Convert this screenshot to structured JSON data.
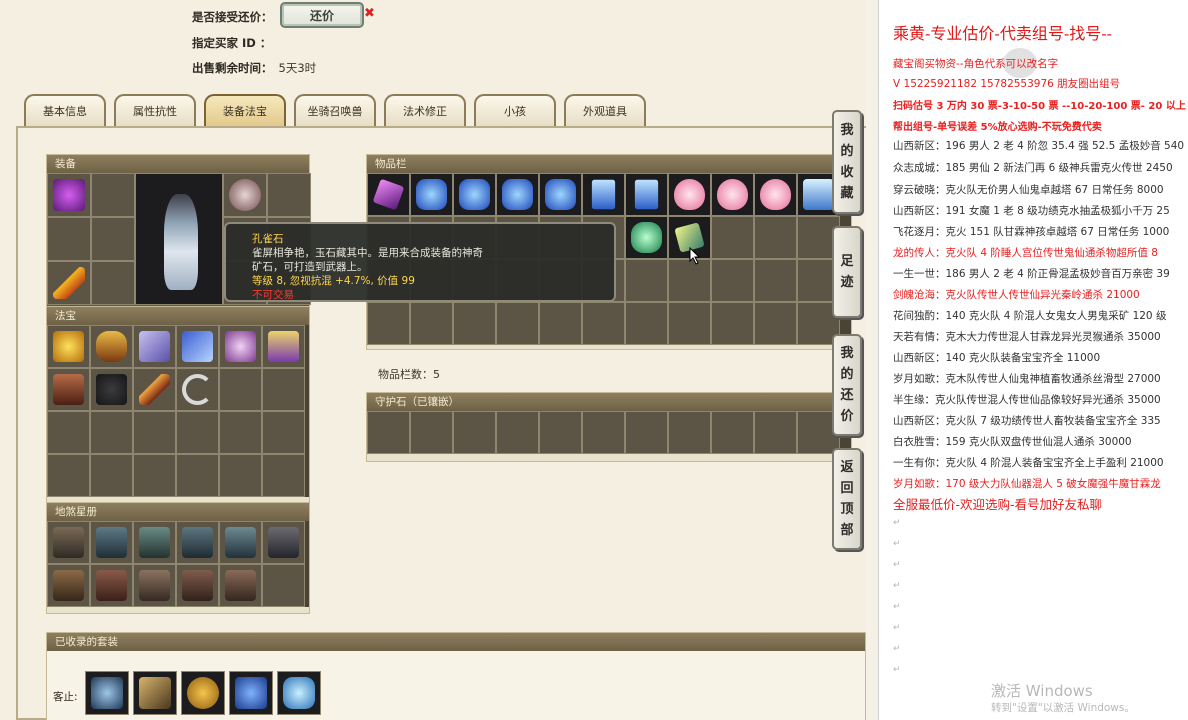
{
  "header": {
    "accept_bargain_label": "是否接受还价：",
    "bargain_button": "还价",
    "bargain_mark": "✖",
    "buyer_id_label": "指定买家 ID ：",
    "time_left_label": "出售剩余时间：",
    "time_left_value": "5天3时"
  },
  "tabs": [
    "基本信息",
    "属性抗性",
    "装备法宝",
    "坐骑召唤兽",
    "法术修正",
    "小孩",
    "外观道具"
  ],
  "active_tab": 2,
  "panels": {
    "equipment": "装备",
    "treasure": "法宝",
    "stars": "地煞星册",
    "inventory": "物品栏",
    "inventory_count": "物品栏数：5",
    "guard_stone": "守护石（已镶嵌）",
    "collected_sets": "已收录的套装",
    "collected_prefix": "客止:"
  },
  "tooltip": {
    "name": "孔雀石",
    "desc1": "雀屏相争艳，玉石藏其中。是用来合成装备的神奇",
    "desc2": "矿石，可打造到武器上。",
    "stat": "等级 8, 忽视抗混 +4.7%, 价值 99",
    "warn": "不可交易"
  },
  "side_buttons": [
    {
      "chars": [
        "我",
        "的",
        "收",
        "藏"
      ]
    },
    {
      "chars": [
        "足",
        "迹"
      ]
    },
    {
      "chars": [
        "我",
        "的",
        "还",
        "价"
      ]
    },
    {
      "chars": [
        "返",
        "回",
        "顶",
        "部"
      ]
    }
  ],
  "doc": {
    "title": "乘黄-专业估价-代卖组号-找号--",
    "lines": [
      {
        "text": "藏宝阁买物资--角色代系可以改名字",
        "style": "red"
      },
      {
        "text": "V 15225921182   15782553976 朋友圈出组号",
        "style": "red"
      },
      {
        "text": "扫码估号 3 万内 30 票-3-10-50 票 --10-20-100 票- 20 以上",
        "style": "redb"
      },
      {
        "text": "帮出组号-单号误差 5%放心选购-不玩免费代卖",
        "style": "redb"
      },
      {
        "text": "山西新区：196 男人 2 老 4 阶忽 35.4 强 52.5 孟极妙音 540",
        "style": "normal"
      },
      {
        "text": "众志成城：185 男仙 2 新法门再 6 级神兵雷克火传世 2450",
        "style": "normal"
      },
      {
        "text": "穿云破晓：克火队无价男人仙鬼卓越塔 67 日常任务 8000",
        "style": "normal"
      },
      {
        "text": "山西新区：191 女魔 1 老 8 级功绩克水抽孟极狐小千万 25",
        "style": "normal"
      },
      {
        "text": "飞花逐月：克火 151 队甘霖神孩卓越塔 67 日常任务 1000",
        "style": "normal"
      },
      {
        "text": "龙的传人：克火队 4 阶睡人宫位传世鬼仙通杀物超所值 8",
        "style": "red"
      },
      {
        "text": "一生一世：186 男人 2 老 4 阶正骨混孟极妙音百万亲密 39",
        "style": "normal"
      },
      {
        "text": "剑魄沧海：克火队传世人传世仙异光秦岭通杀 21000",
        "style": "red"
      },
      {
        "text": "花间独酌：140 克火队 4 阶混人女鬼女人男鬼采矿 120 级",
        "style": "normal"
      },
      {
        "text": "天若有情：克木大力传世混人甘霖龙异光灵猴通杀 35000",
        "style": "normal"
      },
      {
        "text": "山西新区：140 克火队装备宝宝齐全 11000",
        "style": "normal"
      },
      {
        "text": "岁月如歌：克木队传世人仙鬼神植畜牧通杀丝滑型 27000",
        "style": "normal"
      },
      {
        "text": "半生缘：克火队传世混人传世仙品像较好异光通杀 35000",
        "style": "normal"
      },
      {
        "text": "山西新区：克火队 7 级功绩传世人畜牧装备宝宝齐全 335",
        "style": "normal"
      },
      {
        "text": "白衣胜雪：159 克火队双盘传世仙混人通杀 30000",
        "style": "normal"
      },
      {
        "text": "一生有你：克火队 4 阶混人装备宝宝齐全上手盈利 21000",
        "style": "normal"
      },
      {
        "text": "岁月如歌：170 级大力队仙器混人 5 破女魔强牛魔甘霖龙",
        "style": "red"
      },
      {
        "text": "全服最低价-欢迎选购-看号加好友私聊",
        "style": "big"
      }
    ],
    "windows_line1": "激活 Windows",
    "windows_line2": "转到\"设置\"以激活 Windows。"
  },
  "colors": {
    "accent_red": "#e01818",
    "tooltip_gold": "#ffd54a",
    "panel_title": "#7c6f50"
  },
  "icons": [
    "crystal-icon",
    "gem-icon",
    "heart-icon",
    "ore-icon",
    "robe-icon",
    "wand-icon",
    "mask-icon",
    "scroll-icon",
    "whip-icon",
    "fan-icon",
    "flute-icon",
    "pouch-icon",
    "card-icon"
  ]
}
